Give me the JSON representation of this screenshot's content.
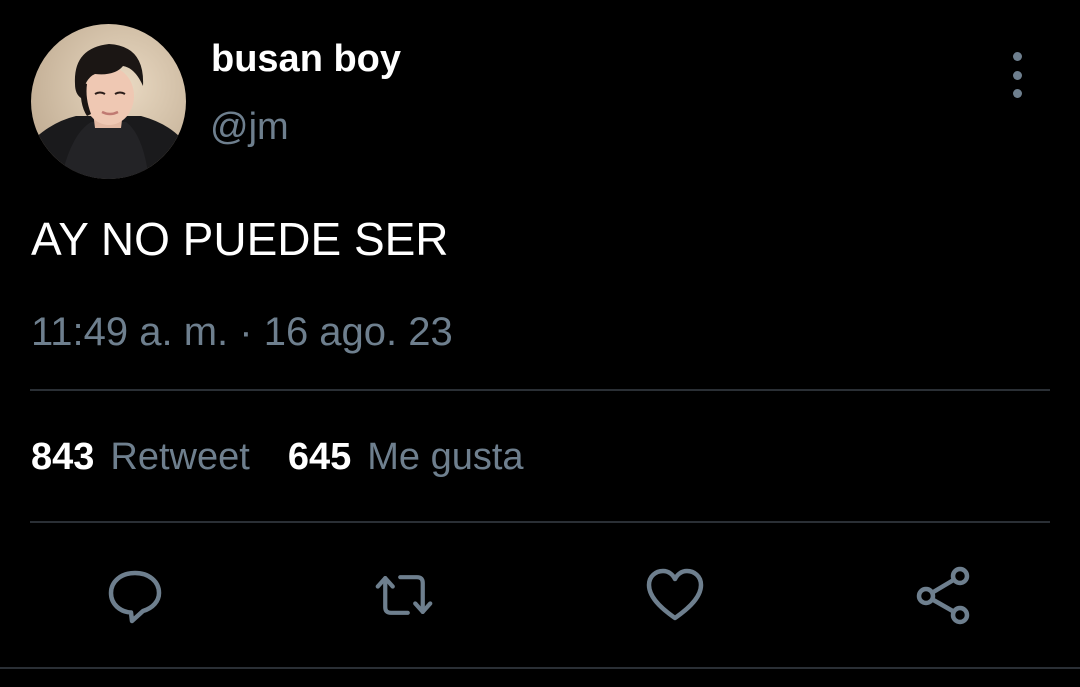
{
  "tweet": {
    "display_name": "busan boy",
    "handle": "@jm",
    "text": "AY NO PUEDE SER",
    "timestamp": "11:49 a. m. · 16 ago. 23",
    "avatar_icon": "profile-photo"
  },
  "stats": {
    "retweets_count": "843",
    "retweets_label": "Retweet",
    "likes_count": "645",
    "likes_label": "Me gusta"
  },
  "actions": {
    "reply_icon": "speech-bubble-icon",
    "retweet_icon": "retweet-arrows-icon",
    "like_icon": "heart-outline-icon",
    "share_icon": "share-nodes-icon",
    "more_icon": "vertical-ellipsis-icon"
  },
  "colors": {
    "background": "#000000",
    "primary_text": "#ffffff",
    "secondary_text": "#6e7f8e",
    "divider": "#2a2f35",
    "icon": "#6e7f8e"
  }
}
